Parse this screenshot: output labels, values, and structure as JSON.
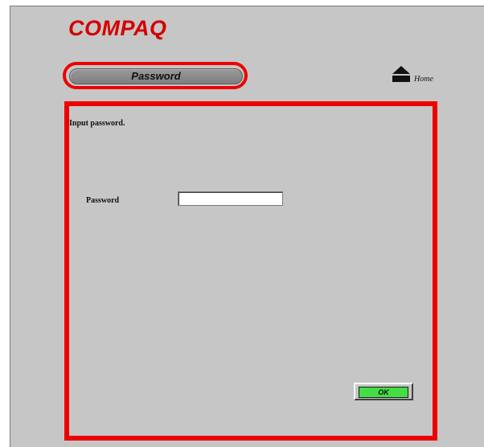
{
  "header": {
    "logo_text": "COMPAQ",
    "section_title": "Password",
    "home_label": "Home",
    "home_icon": "eject-home-icon"
  },
  "form": {
    "instruction": "Input password.",
    "password_label": "Password",
    "password_value": "",
    "ok_label": "OK"
  },
  "colors": {
    "brand_red": "#d40000",
    "frame_red": "#ee0000",
    "background_gray": "#c6c6c6",
    "ok_green": "#44dd44"
  }
}
